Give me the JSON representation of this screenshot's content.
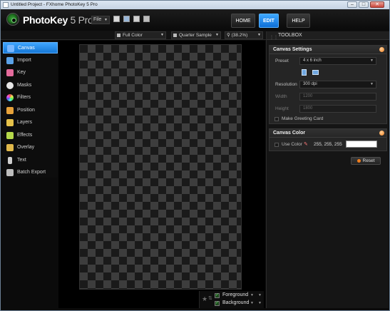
{
  "window": {
    "title": "Untitled Project - FXhome PhotoKey 5 Pro",
    "controls": [
      "–",
      "□",
      "✕"
    ]
  },
  "app": {
    "name": "PhotoKey",
    "version": "5 Pro"
  },
  "menu": {
    "file_label": "File"
  },
  "nav": {
    "home": "HOME",
    "edit": "EDIT",
    "help": "HELP"
  },
  "toolbar": {
    "display_mode": "Full Color",
    "sample": "Quarter Sample",
    "zoom": "(38.2%)"
  },
  "sidebar": {
    "items": [
      {
        "label": "Canvas",
        "icon": "canvas-icon",
        "color": "#7ab8ff"
      },
      {
        "label": "Import",
        "icon": "import-icon",
        "color": "#5aa2e8"
      },
      {
        "label": "Key",
        "icon": "eraser-key-icon",
        "color": "#e46b9c"
      },
      {
        "label": "Masks",
        "icon": "mask-icon",
        "color": "#e6e6e6"
      },
      {
        "label": "Filters",
        "icon": "filters-icon",
        "color": "#d66cd6"
      },
      {
        "label": "Position",
        "icon": "position-icon",
        "color": "#e6a23a"
      },
      {
        "label": "Layers",
        "icon": "layers-icon",
        "color": "#e6c24a"
      },
      {
        "label": "Effects",
        "icon": "effects-icon",
        "color": "#b5d84a"
      },
      {
        "label": "Overlay",
        "icon": "overlay-icon",
        "color": "#e0b84a"
      },
      {
        "label": "Text",
        "icon": "text-icon",
        "color": "#cfcfcf"
      },
      {
        "label": "Batch Export",
        "icon": "batch-export-icon",
        "color": "#cfcfcf"
      }
    ]
  },
  "colors": {
    "foreground": "Foreground",
    "background": "Background"
  },
  "toolbox": {
    "title": "TOOLBOX",
    "canvas_settings": {
      "header": "Canvas Settings",
      "preset_label": "Preset",
      "preset_value": "4 x 6 inch",
      "resolution_label": "Resolution",
      "resolution_value": "300 dpi",
      "width_label": "Width",
      "width_value": "1200",
      "height_label": "Height",
      "height_value": "1800",
      "greeting_label": "Make Greeting Card"
    },
    "canvas_color": {
      "header": "Canvas Color",
      "use_color_label": "Use Color",
      "rgb_value": "255, 255, 255",
      "swatch": "#ffffff"
    },
    "reset_label": "Reset"
  }
}
